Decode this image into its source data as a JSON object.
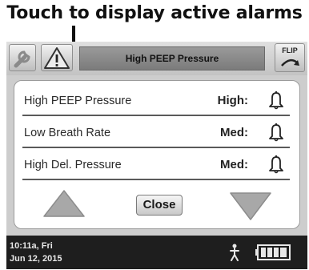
{
  "caption": "Touch to display active alarms",
  "topbar": {
    "title": "High PEEP Pressure",
    "flip_label": "FLIP"
  },
  "alarms": [
    {
      "name": "High PEEP Pressure",
      "level": "High:"
    },
    {
      "name": "Low Breath Rate",
      "level": "Med:"
    },
    {
      "name": "High Del. Pressure",
      "level": "Med:"
    }
  ],
  "close_label": "Close",
  "status": {
    "time": "10:11a, Fri",
    "date": "Jun 12, 2015"
  },
  "icons": {
    "tools": "wrench-icon",
    "alarm": "warning-triangle-icon",
    "flip": "flip-arrow-icon",
    "bell": "bell-icon",
    "up": "up-arrow-icon",
    "down": "down-arrow-icon",
    "person": "person-icon",
    "battery": "battery-icon"
  },
  "colors": {
    "background": "#cdcdcd",
    "statusbar": "#1e1e1e",
    "arrow_fill": "#a8a8a8"
  }
}
